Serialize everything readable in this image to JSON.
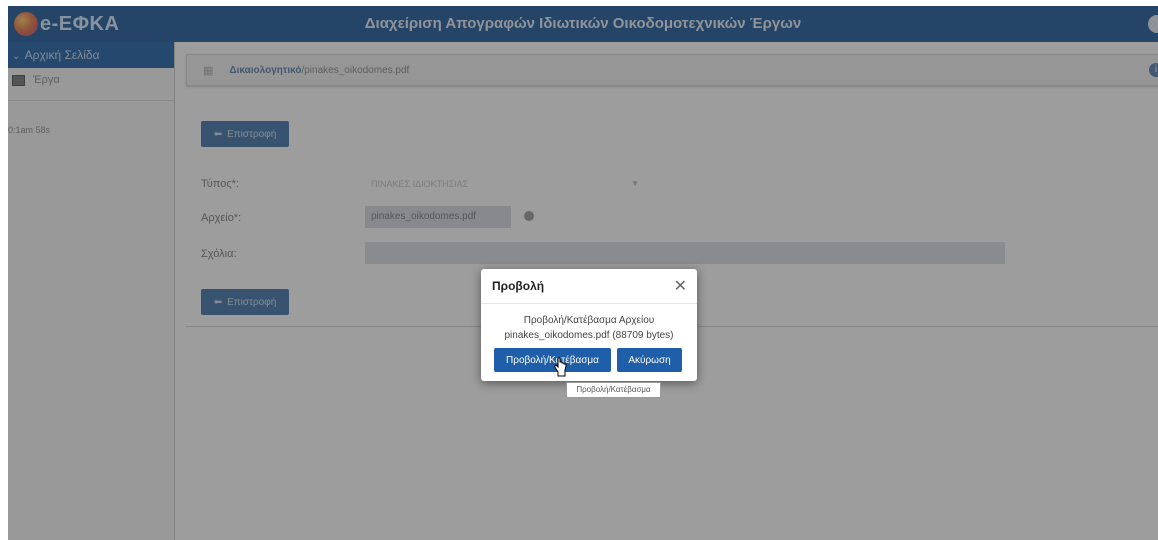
{
  "header": {
    "logo_text": "e-ΕΦΚΑ",
    "title": "Διαχείριση Απογραφών Ιδιωτικών Οικοδομοτεχνικών Έργων"
  },
  "sidebar": {
    "home_label": "Αρχική Σελίδα",
    "items": [
      {
        "label": "Έργα",
        "icon": "folder-icon"
      }
    ],
    "session_timer": "0:1am 58s"
  },
  "breadcrumb": {
    "link_label": "Δικαιολογητικό",
    "separator": "/",
    "file_name": "pinakes_oikodomes.pdf"
  },
  "form": {
    "back_label_top": "Επιστροφή",
    "back_label_bottom": "Επιστροφή",
    "type_label": "Τύπος*:",
    "type_value": "ΠΙΝΑΚΕΣ ΙΔΙΟΚΤΗΣΙΑΣ",
    "file_label": "Αρχείο*:",
    "file_value": "pinakes_oikodomes.pdf",
    "comments_label": "Σχόλια:"
  },
  "modal": {
    "title": "Προβολή",
    "body_line1": "Προβολή/Κατέβασμα Αρχείου",
    "body_line2": "pinakes_oikodomes.pdf (88709 bytes)",
    "primary_button": "Προβολή/Κατέβασμα",
    "cancel_button": "Ακύρωση",
    "tooltip": "Προβολή/Κατέβασμα"
  },
  "colors": {
    "header": "#3b6fa8",
    "primary": "#1f5ea8",
    "overlay": "rgba(0,0,0,0.38)"
  }
}
